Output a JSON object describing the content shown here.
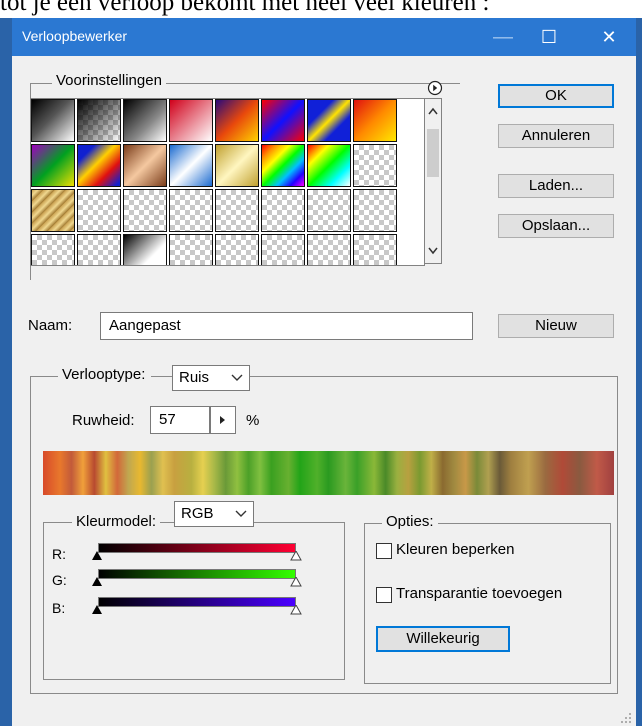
{
  "caption": "tot je een verloop bekomt met heel veel kleuren :",
  "window": {
    "title": "Verloopbewerker",
    "minimize": "—",
    "maximize": "☐",
    "close": "✕"
  },
  "presets": {
    "legend": "Voorinstellingen",
    "menu_icon": "circle-arrow-icon"
  },
  "buttons": {
    "ok": "OK",
    "cancel": "Annuleren",
    "load": "Laden...",
    "save": "Opslaan...",
    "new": "Nieuw"
  },
  "name": {
    "label": "Naam:",
    "value": "Aangepast"
  },
  "gradient_type": {
    "label": "Verlooptype:",
    "value": "Ruis"
  },
  "roughness": {
    "label": "Ruwheid:",
    "value": "57",
    "unit": "%"
  },
  "color_model": {
    "label": "Kleurmodel:",
    "value": "RGB",
    "channels": [
      "R:",
      "G:",
      "B:"
    ]
  },
  "options": {
    "legend": "Opties:",
    "restrict_colors": "Kleuren beperken",
    "add_transparency": "Transparantie toevoegen",
    "randomize": "Willekeurig"
  },
  "colors": {
    "titlebar": "#2b78d2",
    "focus": "#0078d7"
  }
}
